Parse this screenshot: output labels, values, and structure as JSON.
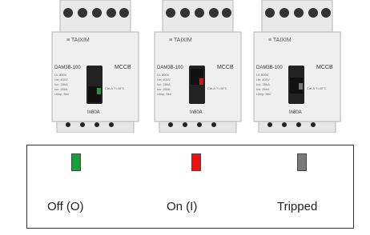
{
  "breakers": [
    {
      "brand": "≡ TAIXIM",
      "model": "DAM3B-100",
      "type_label": "MCCB",
      "rating": "In80A",
      "spec_text": [
        "Ui: 800V",
        "Ue: 400V",
        "Icu: 35kA",
        "Ics: 25kA",
        "Uimp: 8kV"
      ],
      "standard": "Cat.A  T=40°C",
      "handle_state": "off",
      "indicator_color": "#159a3a"
    },
    {
      "brand": "≡ TAIXIM",
      "model": "DAM3B-100",
      "type_label": "MCCB",
      "rating": "In80A",
      "spec_text": [
        "Ui: 800V",
        "Ue: 400V",
        "Icu: 35kA",
        "Ics: 25kA",
        "Uimp: 8kV"
      ],
      "standard": "Cat.A  T=40°C",
      "handle_state": "on",
      "indicator_color": "#e01010"
    },
    {
      "brand": "≡ TAIXIM",
      "model": "DAM3B-100",
      "type_label": "MCCB",
      "rating": "In80A",
      "spec_text": [
        "Ui: 800V",
        "Ue: 400V",
        "Icu: 35kA",
        "Ics: 25kA",
        "Uimp: 8kV"
      ],
      "standard": "Cat.A  T=40°C",
      "handle_state": "tripped",
      "indicator_color": "#777777"
    }
  ],
  "legend": {
    "items": [
      {
        "label": "Off (O)",
        "color": "#15a03c"
      },
      {
        "label": "On (I)",
        "color": "#ee1111"
      },
      {
        "label": "Tripped",
        "color": "#7a7a7a"
      }
    ]
  }
}
